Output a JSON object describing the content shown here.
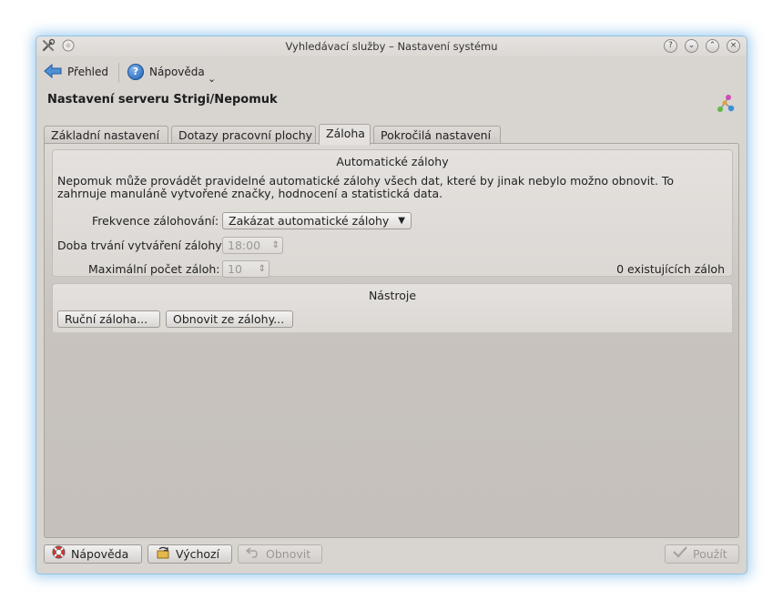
{
  "window": {
    "title": "Vyhledávací služby – Nastavení systému",
    "buttons": [
      "?",
      "⌄",
      "⌃",
      "×"
    ]
  },
  "toolbar": {
    "overview_label": "Přehled",
    "help_label": "Nápověda",
    "dropdown_glyph": "⌄"
  },
  "page": {
    "title": "Nastavení serveru Strigi/Nepomuk"
  },
  "tabs": [
    {
      "label": "Základní nastavení",
      "active": false
    },
    {
      "label": "Dotazy pracovní plochy",
      "active": false
    },
    {
      "label": "Záloha",
      "active": true
    },
    {
      "label": "Pokročilá nastavení",
      "active": false
    }
  ],
  "auto_backup": {
    "title": "Automatické zálohy",
    "description": "Nepomuk může provádět pravidelné automatické zálohy všech dat, které by jinak nebylo možno obnovit. To zahrnuje manuláně vytvořené značky, hodnocení a statistická data.",
    "frequency_label": "Frekvence zálohování:",
    "frequency_value": "Zakázat automatické zálohy",
    "time_label": "Doba trvání vytváření zálohy:",
    "time_value": "18:00",
    "max_label": "Maximální počet záloh:",
    "max_value": "10",
    "existing_count": "0 existujících záloh"
  },
  "tools": {
    "title": "Nástroje",
    "manual_backup_label": "Ruční záloha...",
    "restore_label": "Obnovit ze zálohy..."
  },
  "bottom": {
    "help_label": "Nápověda",
    "defaults_label": "Výchozí",
    "reset_label": "Obnovit",
    "apply_label": "Použít"
  },
  "colors": {
    "window_glow": "#5caae1",
    "panel_bg": "#d8d4d0",
    "help_blue": "#1f5fb2"
  }
}
